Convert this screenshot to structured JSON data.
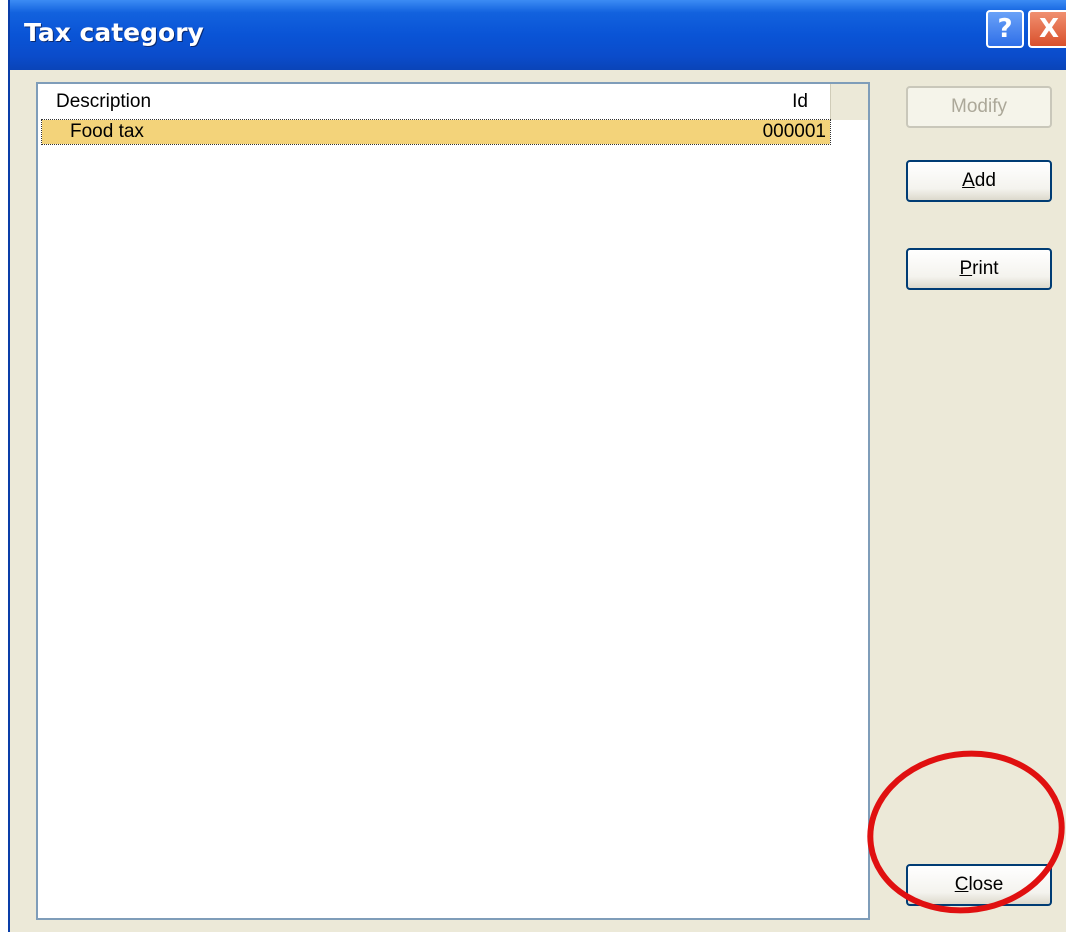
{
  "window": {
    "title": "Tax category",
    "help_glyph": "?",
    "close_glyph": "X"
  },
  "list": {
    "columns": {
      "description": "Description",
      "id": "Id"
    },
    "rows": [
      {
        "description": "Food tax",
        "id": "000001"
      }
    ]
  },
  "buttons": {
    "modify": {
      "label": "Modify",
      "enabled": false
    },
    "add": {
      "label_accel": "A",
      "label_rest": "dd"
    },
    "print": {
      "label_accel": "P",
      "label_rest": "rint"
    },
    "close": {
      "label_accel": "C",
      "label_rest": "lose"
    }
  },
  "annotation": {
    "shape": "ellipse",
    "color": "#e01010",
    "target": "close-button"
  }
}
